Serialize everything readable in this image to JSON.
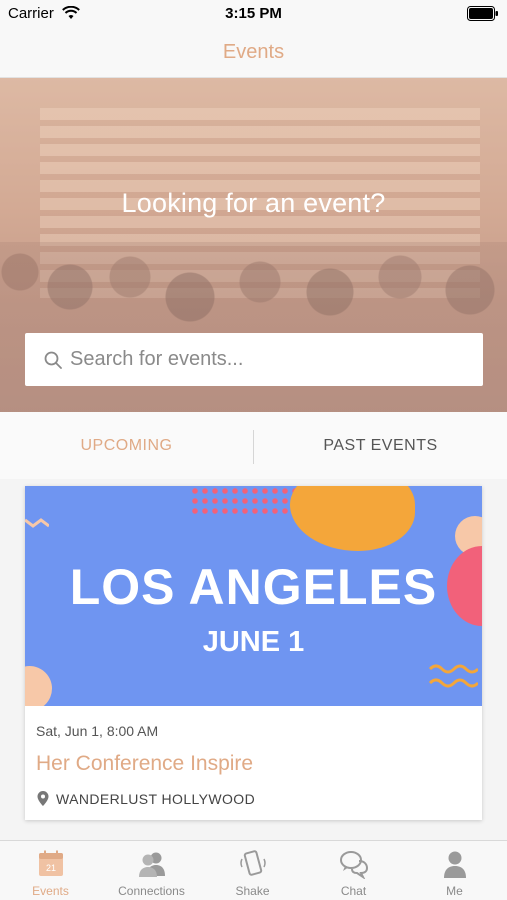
{
  "status_bar": {
    "carrier": "Carrier",
    "time": "3:15 PM"
  },
  "nav": {
    "title": "Events"
  },
  "hero": {
    "heading": "Looking for an event?"
  },
  "search": {
    "placeholder": "Search for events...",
    "value": ""
  },
  "tabs": [
    {
      "label": "UPCOMING",
      "active": true
    },
    {
      "label": "PAST EVENTS",
      "active": false
    }
  ],
  "event": {
    "banner_city": "LOS ANGELES",
    "banner_date": "JUNE 1",
    "datetime": "Sat, Jun 1, 8:00 AM",
    "title": "Her Conference Inspire",
    "venue": "WANDERLUST HOLLYWOOD"
  },
  "tab_bar": {
    "items": [
      {
        "label": "Events",
        "icon": "calendar-icon",
        "badge": "21",
        "active": true
      },
      {
        "label": "Connections",
        "icon": "people-icon",
        "active": false
      },
      {
        "label": "Shake",
        "icon": "phone-shake-icon",
        "active": false
      },
      {
        "label": "Chat",
        "icon": "chat-bubbles-icon",
        "active": false
      },
      {
        "label": "Me",
        "icon": "person-icon",
        "active": false
      }
    ]
  },
  "colors": {
    "accent": "#e0aa86",
    "banner_blue": "#6f95f1",
    "banner_orange": "#f4a63a",
    "banner_pink": "#f2617a"
  }
}
